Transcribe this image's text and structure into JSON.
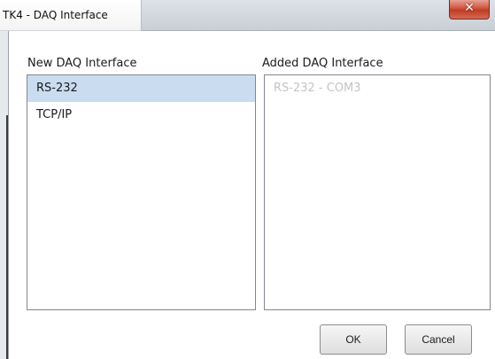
{
  "window": {
    "title": "TK4 - DAQ Interface",
    "close_icon": "close-icon",
    "close_glyph": "✕"
  },
  "new_interface": {
    "label": "New DAQ Interface",
    "items": [
      {
        "label": "RS-232",
        "selected": true
      },
      {
        "label": "TCP/IP",
        "selected": false
      }
    ]
  },
  "added_interface": {
    "label": "Added DAQ Interface",
    "items": [
      {
        "label": "RS-232 - COM3",
        "disabled": true
      }
    ]
  },
  "buttons": {
    "ok_label": "OK",
    "cancel_label": "Cancel"
  },
  "colors": {
    "selection": "#cadcf0",
    "close_button": "#c23a22",
    "disabled_text": "#c4c4c4"
  }
}
